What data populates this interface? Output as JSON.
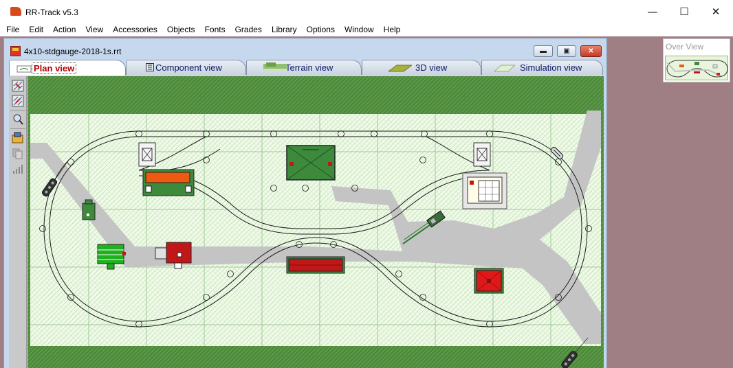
{
  "app": {
    "title": "RR-Track v5.3"
  },
  "window_controls": {
    "minimize": "—",
    "maximize": "☐",
    "close": "✕"
  },
  "menu": [
    "File",
    "Edit",
    "Action",
    "View",
    "Accessories",
    "Objects",
    "Fonts",
    "Grades",
    "Library",
    "Options",
    "Window",
    "Help"
  ],
  "document": {
    "title": "4x10-stdgauge-2018-1s.rrt",
    "controls": {
      "minimize": "▬",
      "restore": "▣",
      "close": "✕"
    }
  },
  "tabs": [
    {
      "label": "Plan view",
      "active": true
    },
    {
      "label": "Component view",
      "active": false
    },
    {
      "label": "Terrain view",
      "active": false
    },
    {
      "label": "3D view",
      "active": false
    },
    {
      "label": "Simulation view",
      "active": false
    }
  ],
  "toolbar": [
    "select-tool-icon",
    "select-area-icon",
    "zoom-icon",
    "edit-object-icon",
    "copy-icon",
    "grade-icon"
  ],
  "overview": {
    "title": "Over View"
  },
  "colors": {
    "grass": "#4f8b3f",
    "grid_line": "#9bc590",
    "road": "#c4c4c4",
    "track": "#1e1e1e",
    "building_green": "#3d8a3d",
    "building_red": "#c01818",
    "building_orange": "#f05a10"
  }
}
